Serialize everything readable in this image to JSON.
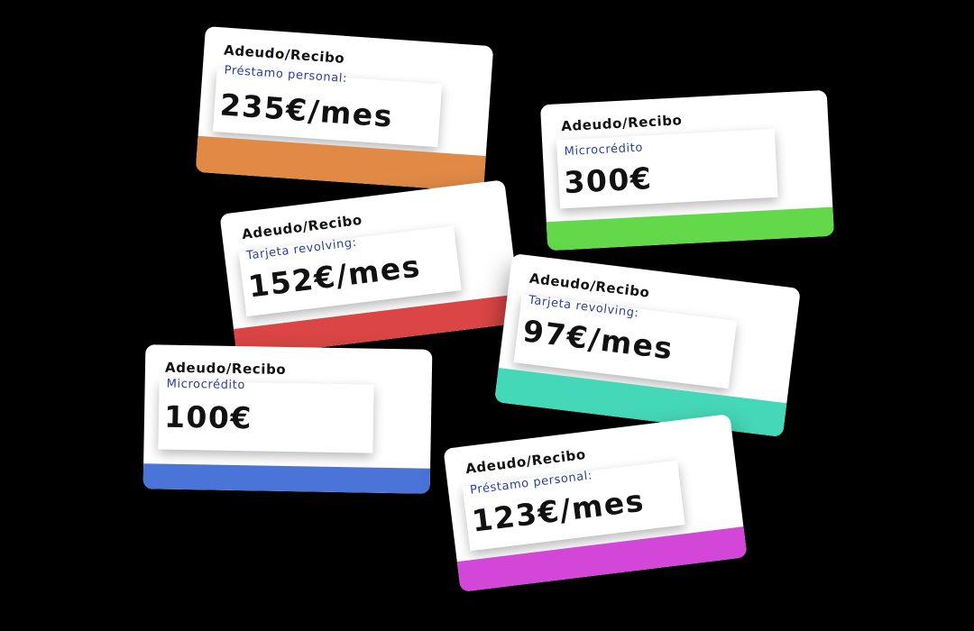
{
  "cards": [
    {
      "title": "Adeudo/Recibo",
      "type": "Préstamo personal:",
      "amount": "235€/mes",
      "stripe_color": "#e08a46"
    },
    {
      "title": "Adeudo/Recibo",
      "type": "Microcrédito",
      "amount": "300€",
      "stripe_color": "#62d84a"
    },
    {
      "title": "Adeudo/Recibo",
      "type": "Tarjeta revolving:",
      "amount": "152€/mes",
      "stripe_color": "#dc4545"
    },
    {
      "title": "Adeudo/Recibo",
      "type": "Tarjeta revolving:",
      "amount": "97€/mes",
      "stripe_color": "#45d8b8"
    },
    {
      "title": "Adeudo/Recibo",
      "type": "Microcrédito",
      "amount": "100€",
      "stripe_color": "#4a74d8"
    },
    {
      "title": "Adeudo/Recibo",
      "type": "Préstamo personal:",
      "amount": "123€/mes",
      "stripe_color": "#d246d8"
    }
  ]
}
